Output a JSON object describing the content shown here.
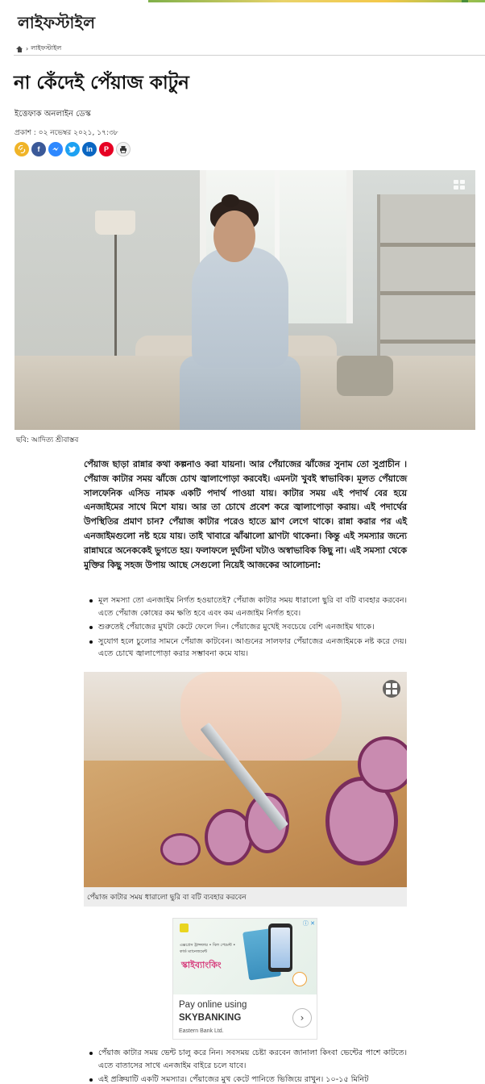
{
  "section": {
    "title": "লাইফস্টাইল"
  },
  "breadcrumb": {
    "current": "লাইফস্টাইল",
    "separator": "›"
  },
  "article": {
    "headline": "না কেঁদেই পেঁয়াজ কাটুন",
    "author": "ইত্তেফাক অনলাইন ডেস্ক",
    "published_label": "প্রকাশ :",
    "published_date": "০২ নভেম্বর ২০২১,",
    "published_time": "১৭:৩৮",
    "hero_caption": "ছবি: আদিত্য শ্রীবাস্তব",
    "intro": "পেঁয়াজ ছাড়া রান্নার কথা কল্পনাও করা যায়না। আর পেঁয়াজের ঝাঁজের সুনাম তো সুপ্রাচীন । পেঁয়াজ কাটার সময় ঝাঁজে চোখ জ্বালাপোড়া করবেই। এমনটা খুবই স্বাভাবিক। মূলত পেঁয়াজে সালফেনিক এসিড নামক একটি পদার্থ পাওয়া যায়। কাটার সময় এই পদার্থ বের হয়ে এনজাইমের সাথে মিশে যায়। আর তা চোখে প্রবেশ করে জ্বালাপোড়া করায়। এই পদার্থের উপস্থিতির প্রমাণ চান? পেঁয়াজ কাটার পরেও হাতে ঘ্রাণ লেগে থাকে। রান্না করার পর এই এনজাইমগুলো নষ্ট হয়ে যায়। তাই খাবারে ঝাঁঝালো ঘ্রাণটা থাকেনা। কিন্তু এই সমস্যার জন্যে রান্নাঘরে অনেককেই ভুগতে হয়। ফলাফলে দুর্ঘটনা ঘটাও অস্বাভাবিক কিছু না। এই সমস্যা থেকে মুক্তির কিছু সহজ উপায় আছে সেগুলো নিয়েই আজকের আলোচনা:",
    "tips_a": [
      "মূল সমস্যা তো এনজাইম নির্গত হওয়াতেই? পেঁয়াজ কাটার সময় ধারালো ছুরি বা বটি ব্যবহার করবেন। এতে পেঁয়াজ কোষের কম ক্ষতি হবে এবং কম এনজাইম নির্গত হবে।",
      "শুরুতেই পেঁয়াজের মুখটা কেটে ফেলে দিন। পেঁয়াজের মুখেই সবচেয়ে বেশি এনজাইম থাকে।",
      "সুযোগ হলে চুলোর সামনে পেঁয়াজ কাটবেন। আগুনের সালফার পেঁয়াজের এনজাইমকে নষ্ট করে দেয়। এতে চোখে জ্বালাপোড়া করার সম্ভাবনা কমে যায়।"
    ],
    "onion_caption": "পেঁয়াজ কাটার সময় ধারালো ছুরি বা বটি ব্যবহার করবেন",
    "tips_b": [
      "পেঁয়াজ কাটার সময় ভেন্ট চালু করে নিন। সবসময় চেষ্টা করবেন জানালা কিংবা ভেন্টের পাশে কাটতে। এতে বাতাসের সাথে এনজাইম বাইরে চলে যাবে।",
      "এই প্রক্রিয়াটি একটি সমস্যার। পেঁয়াজের মুখ কেটে পানিতে ভিজিয়ে রাখুন। ১০-১৫ মিনিট"
    ]
  },
  "share": {
    "icons": [
      "link-icon",
      "facebook-icon",
      "messenger-icon",
      "twitter-icon",
      "linkedin-icon",
      "pinterest-icon",
      "print-icon"
    ],
    "colors": [
      "#f0b428",
      "#3b5998",
      "#2d88ff",
      "#1da1f2",
      "#0a66c2",
      "#e60023",
      "#f2f2f2"
    ]
  },
  "ad": {
    "bangla_title": "স্কাইব্যাংকিং",
    "small_text": "এক্সপ্রেস ট্রান্সফার • বিল পেমেন্ট • কার্ড ম্যানেজমেন্ট",
    "cta_line1": "Pay online using",
    "cta_line2": "SKYBANKING",
    "source": "Eastern Bank Ltd.",
    "choices": "ⓘ ✕",
    "arrow": "›"
  }
}
